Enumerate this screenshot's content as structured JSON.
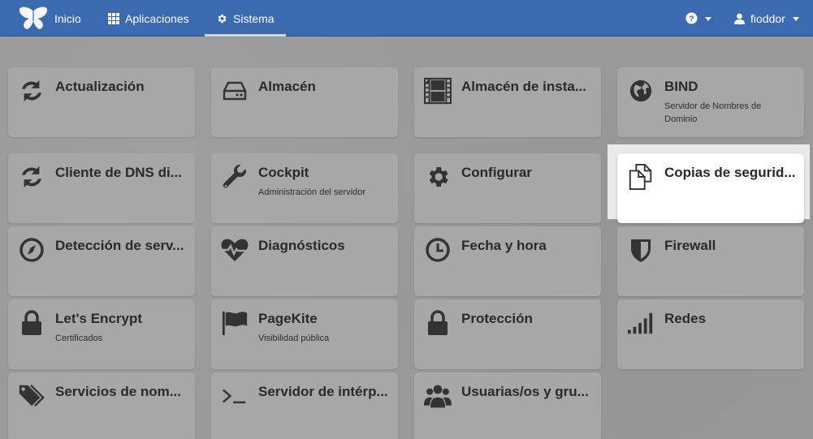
{
  "navbar": {
    "logo": "freedombox-logo-icon",
    "home": "Inicio",
    "apps": "Aplicaciones",
    "system": "Sistema",
    "help_icon": "question-circle-icon",
    "user": "fioddor",
    "colors": {
      "bar": "#3c6ab1",
      "active_underline": "#cfd6e0"
    }
  },
  "tiles": [
    {
      "title": "Actualización",
      "desc": "",
      "icon": "refresh-icon"
    },
    {
      "title": "Almacén",
      "desc": "",
      "icon": "hard-drive-icon"
    },
    {
      "title": "Almacén de insta...",
      "desc": "",
      "icon": "film-icon"
    },
    {
      "title": "BIND",
      "desc": "Servidor de Nombres de Dominio",
      "icon": "globe-icon"
    },
    {
      "title": "Cliente de DNS di...",
      "desc": "",
      "icon": "refresh-icon"
    },
    {
      "title": "Cockpit",
      "desc": "Administración del servidor",
      "icon": "wrench-icon"
    },
    {
      "title": "Configurar",
      "desc": "",
      "icon": "gear-icon"
    },
    {
      "title": "Copias de segurid...",
      "desc": "",
      "icon": "copy-icon"
    },
    {
      "title": "Detección de serv...",
      "desc": "",
      "icon": "compass-icon"
    },
    {
      "title": "Diagnósticos",
      "desc": "",
      "icon": "heartbeat-icon"
    },
    {
      "title": "Fecha y hora",
      "desc": "",
      "icon": "clock-icon"
    },
    {
      "title": "Firewall",
      "desc": "",
      "icon": "shield-icon"
    },
    {
      "title": "Let's Encrypt",
      "desc": "Certificados",
      "icon": "lock-icon"
    },
    {
      "title": "PageKite",
      "desc": "Visibilidad pública",
      "icon": "flag-icon"
    },
    {
      "title": "Protección",
      "desc": "",
      "icon": "lock-icon"
    },
    {
      "title": "Redes",
      "desc": "",
      "icon": "signal-icon"
    },
    {
      "title": "Servicios de nom...",
      "desc": "",
      "icon": "tags-icon"
    },
    {
      "title": "Servidor de intérp...",
      "desc": "",
      "icon": "terminal-icon"
    },
    {
      "title": "Usuarias/os y gru...",
      "desc": "",
      "icon": "users-icon"
    }
  ]
}
